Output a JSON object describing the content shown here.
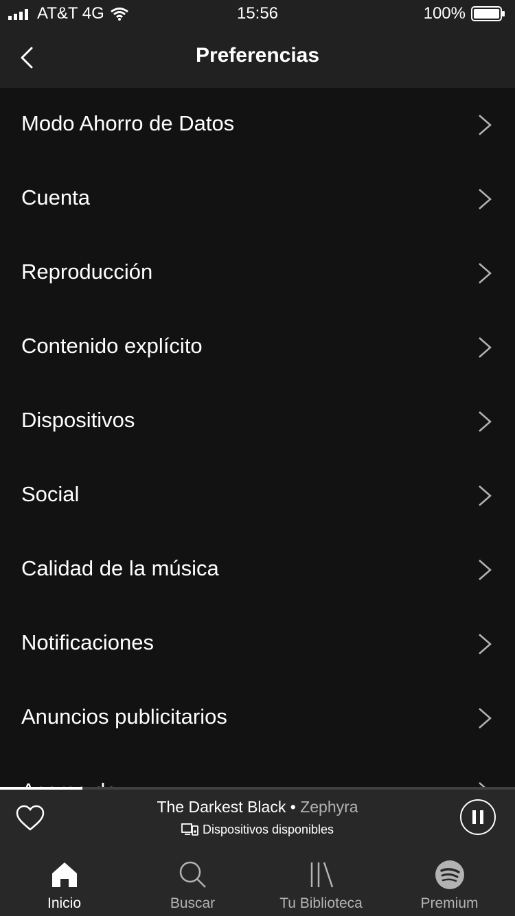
{
  "status": {
    "carrier": "AT&T 4G",
    "time": "15:56",
    "battery": "100%"
  },
  "header": {
    "title": "Preferencias"
  },
  "menu": [
    {
      "label": "Modo Ahorro de Datos"
    },
    {
      "label": "Cuenta"
    },
    {
      "label": "Reproducción"
    },
    {
      "label": "Contenido explícito"
    },
    {
      "label": "Dispositivos"
    },
    {
      "label": "Social"
    },
    {
      "label": "Calidad de la música"
    },
    {
      "label": "Notificaciones"
    },
    {
      "label": "Anuncios publicitarios"
    },
    {
      "label": "Acerca de"
    }
  ],
  "player": {
    "track_title": "The Darkest Black",
    "separator": " • ",
    "artist": "Zephyra",
    "devices_label": "Dispositivos disponibles",
    "progress": 0.16
  },
  "tabs": [
    {
      "label": "Inicio",
      "icon": "home-icon",
      "active": true
    },
    {
      "label": "Buscar",
      "icon": "search-icon",
      "active": false
    },
    {
      "label": "Tu Biblioteca",
      "icon": "library-icon",
      "active": false
    },
    {
      "label": "Premium",
      "icon": "spotify-icon",
      "active": false
    }
  ],
  "colors": {
    "background": "#121212",
    "header": "#212121",
    "player": "#282828",
    "text_secondary": "#b3b3b3"
  }
}
